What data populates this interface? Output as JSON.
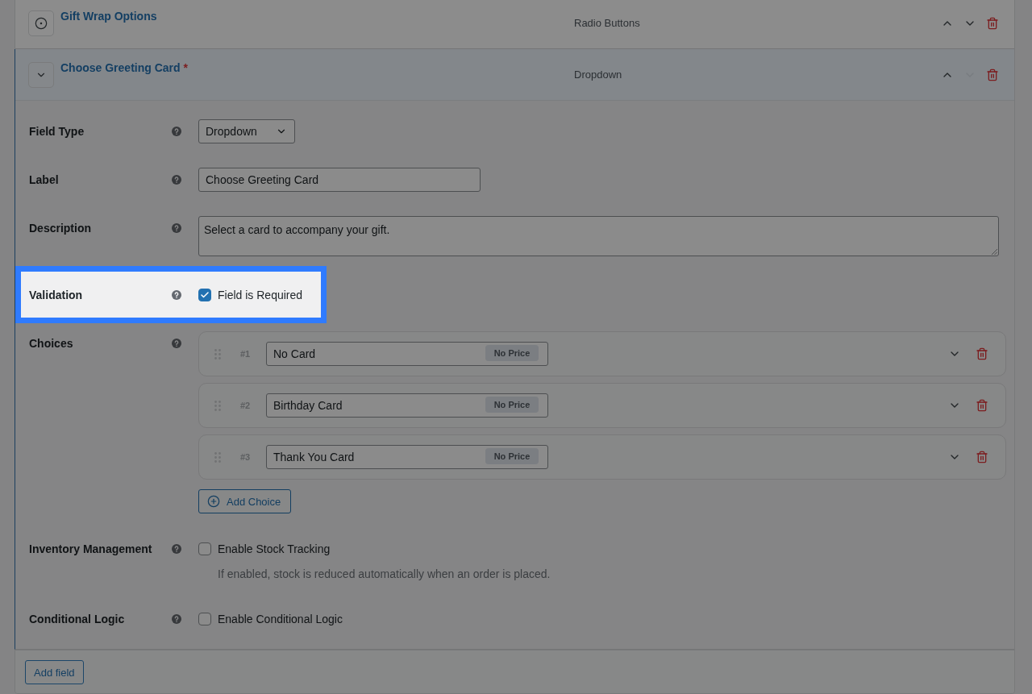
{
  "fields": [
    {
      "title": "Gift Wrap Options",
      "type_label": "Radio Buttons",
      "expanded": false,
      "move_up_disabled": false,
      "move_down_disabled": false
    },
    {
      "title": "Choose Greeting Card",
      "required_mark": "*",
      "type_label": "Dropdown",
      "expanded": true,
      "move_up_disabled": false,
      "move_down_disabled": true,
      "settings": [
        {
          "kind": "select",
          "label": "Field Type",
          "value": "Dropdown",
          "highlighted": false
        },
        {
          "kind": "text",
          "label": "Label",
          "value": "Choose Greeting Card",
          "highlighted": false
        },
        {
          "kind": "textarea",
          "label": "Description",
          "value": "Select a card to accompany your gift.",
          "highlighted": false
        },
        {
          "kind": "checkbox",
          "label": "Validation",
          "option": "Field is Required",
          "checked": true,
          "highlighted": true
        },
        {
          "kind": "choices",
          "label": "Choices",
          "choices": [
            {
              "number": "#1",
              "label": "No Card",
              "price": "No Price"
            },
            {
              "number": "#2",
              "label": "Birthday Card",
              "price": "No Price"
            },
            {
              "number": "#3",
              "label": "Thank You Card",
              "price": "No Price"
            }
          ],
          "add_button": "Add Choice",
          "highlighted": false
        },
        {
          "kind": "checkbox",
          "label": "Inventory Management",
          "option": "Enable Stock Tracking",
          "checked": false,
          "hint": "If enabled, stock is reduced automatically when an order is placed.",
          "highlighted": false
        },
        {
          "kind": "checkbox",
          "label": "Conditional Logic",
          "option": "Enable Conditional Logic",
          "checked": false,
          "highlighted": false
        }
      ]
    }
  ],
  "add_field_button": "Add field"
}
